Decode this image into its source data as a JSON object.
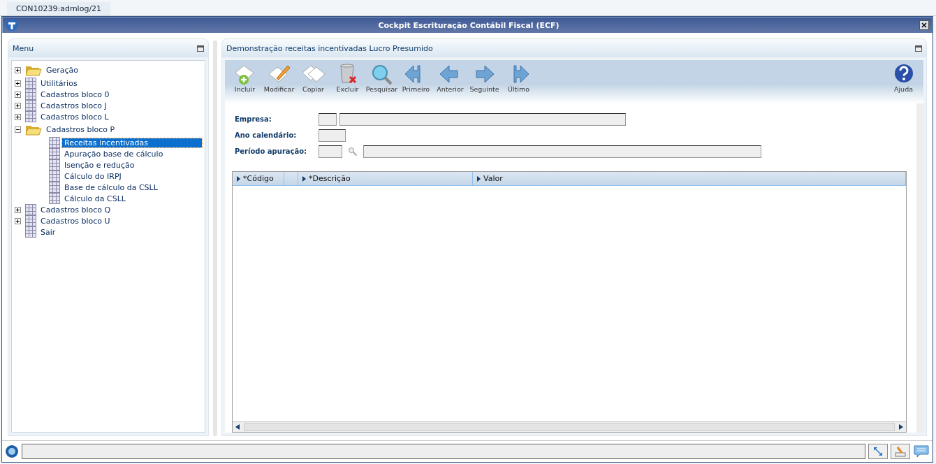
{
  "tab": {
    "label": "CON10239:admlog/21"
  },
  "window": {
    "title": "Cockpit Escrituração Contábil Fiscal (ECF)"
  },
  "menu": {
    "title": "Menu",
    "items": [
      {
        "label": "Geração",
        "kind": "folder",
        "expanded": false,
        "selected": false
      },
      {
        "label": "Utilitários",
        "kind": "table",
        "expanded": false,
        "selected": false
      },
      {
        "label": "Cadastros bloco 0",
        "kind": "table",
        "expanded": false,
        "selected": false
      },
      {
        "label": "Cadastros bloco J",
        "kind": "table",
        "expanded": false,
        "selected": false
      },
      {
        "label": "Cadastros bloco L",
        "kind": "table",
        "expanded": false,
        "selected": false
      },
      {
        "label": "Cadastros bloco P",
        "kind": "folder",
        "expanded": true,
        "selected": false,
        "children": [
          {
            "label": "Receitas incentivadas",
            "kind": "table",
            "selected": true
          },
          {
            "label": "Apuração base de cálculo",
            "kind": "table",
            "selected": false
          },
          {
            "label": "Isenção e redução",
            "kind": "table",
            "selected": false
          },
          {
            "label": "Cálculo do IRPJ",
            "kind": "table",
            "selected": false
          },
          {
            "label": "Base de cálculo da CSLL",
            "kind": "table",
            "selected": false
          },
          {
            "label": "Cálculo da CSLL",
            "kind": "table",
            "selected": false
          }
        ]
      },
      {
        "label": "Cadastros bloco Q",
        "kind": "table",
        "expanded": false,
        "selected": false
      },
      {
        "label": "Cadastros bloco U",
        "kind": "table",
        "expanded": false,
        "selected": false
      },
      {
        "label": "Sair",
        "kind": "table",
        "selected": false
      }
    ]
  },
  "panel": {
    "title": "Demonstração receitas incentivadas Lucro Presumido",
    "toolbar": [
      {
        "label": "Incluir",
        "kind": "add"
      },
      {
        "label": "Modificar",
        "kind": "edit"
      },
      {
        "label": "Copiar",
        "kind": "copy"
      },
      {
        "label": "Excluir",
        "kind": "delete"
      },
      {
        "label": "Pesquisar",
        "kind": "search"
      },
      {
        "label": "Primeiro",
        "kind": "first"
      },
      {
        "label": "Anterior",
        "kind": "prev"
      },
      {
        "label": "Seguinte",
        "kind": "next"
      },
      {
        "label": "Último",
        "kind": "last"
      }
    ],
    "help": {
      "label": "Ajuda"
    },
    "form": [
      {
        "label": "Empresa:",
        "kind": "code-name"
      },
      {
        "label": "Ano calendário:",
        "kind": "short"
      },
      {
        "label": "Período apuração:",
        "kind": "lookup"
      }
    ],
    "grid": {
      "columns": [
        "*Código",
        "*Descrição",
        "Valor"
      ]
    }
  }
}
